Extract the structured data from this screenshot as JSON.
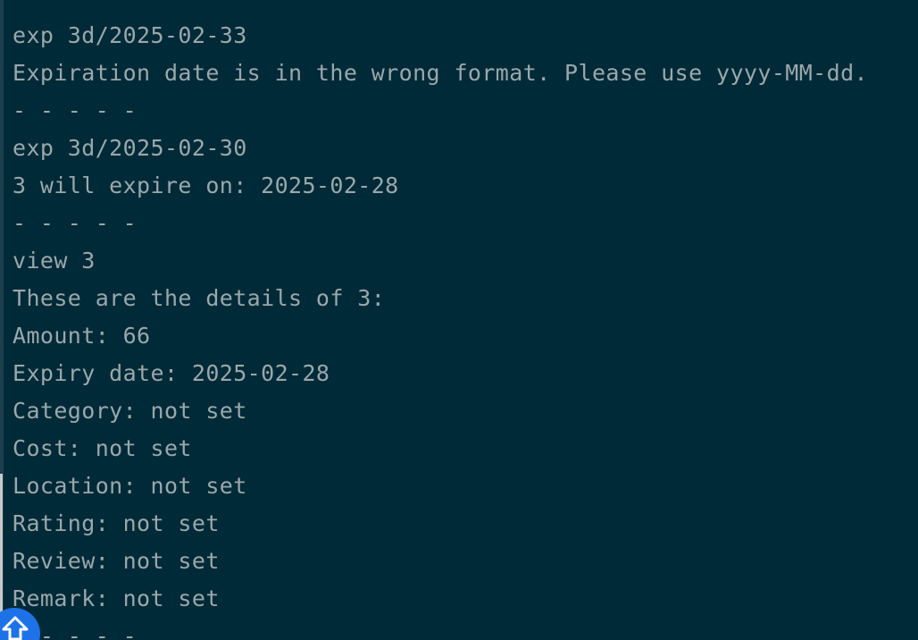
{
  "terminal": {
    "lines": [
      "exp 3d/2025-02-33",
      "Expiration date is in the wrong format. Please use yyyy-MM-dd.",
      "- - - - -",
      "exp 3d/2025-02-30",
      "3 will expire on: 2025-02-28",
      "- - - - -",
      "view 3",
      "These are the details of 3:",
      "Amount: 66",
      "Expiry date: 2025-02-28",
      "Category: not set",
      "Cost: not set",
      "Location: not set",
      "Rating: not set",
      "Review: not set",
      "Remark: not set",
      "- - - - -"
    ]
  },
  "badge": {
    "icon": "shift-up-arrow-icon"
  },
  "colors": {
    "background": "#012a38",
    "text": "#9aa7ab",
    "badge": "#1e72e8"
  }
}
